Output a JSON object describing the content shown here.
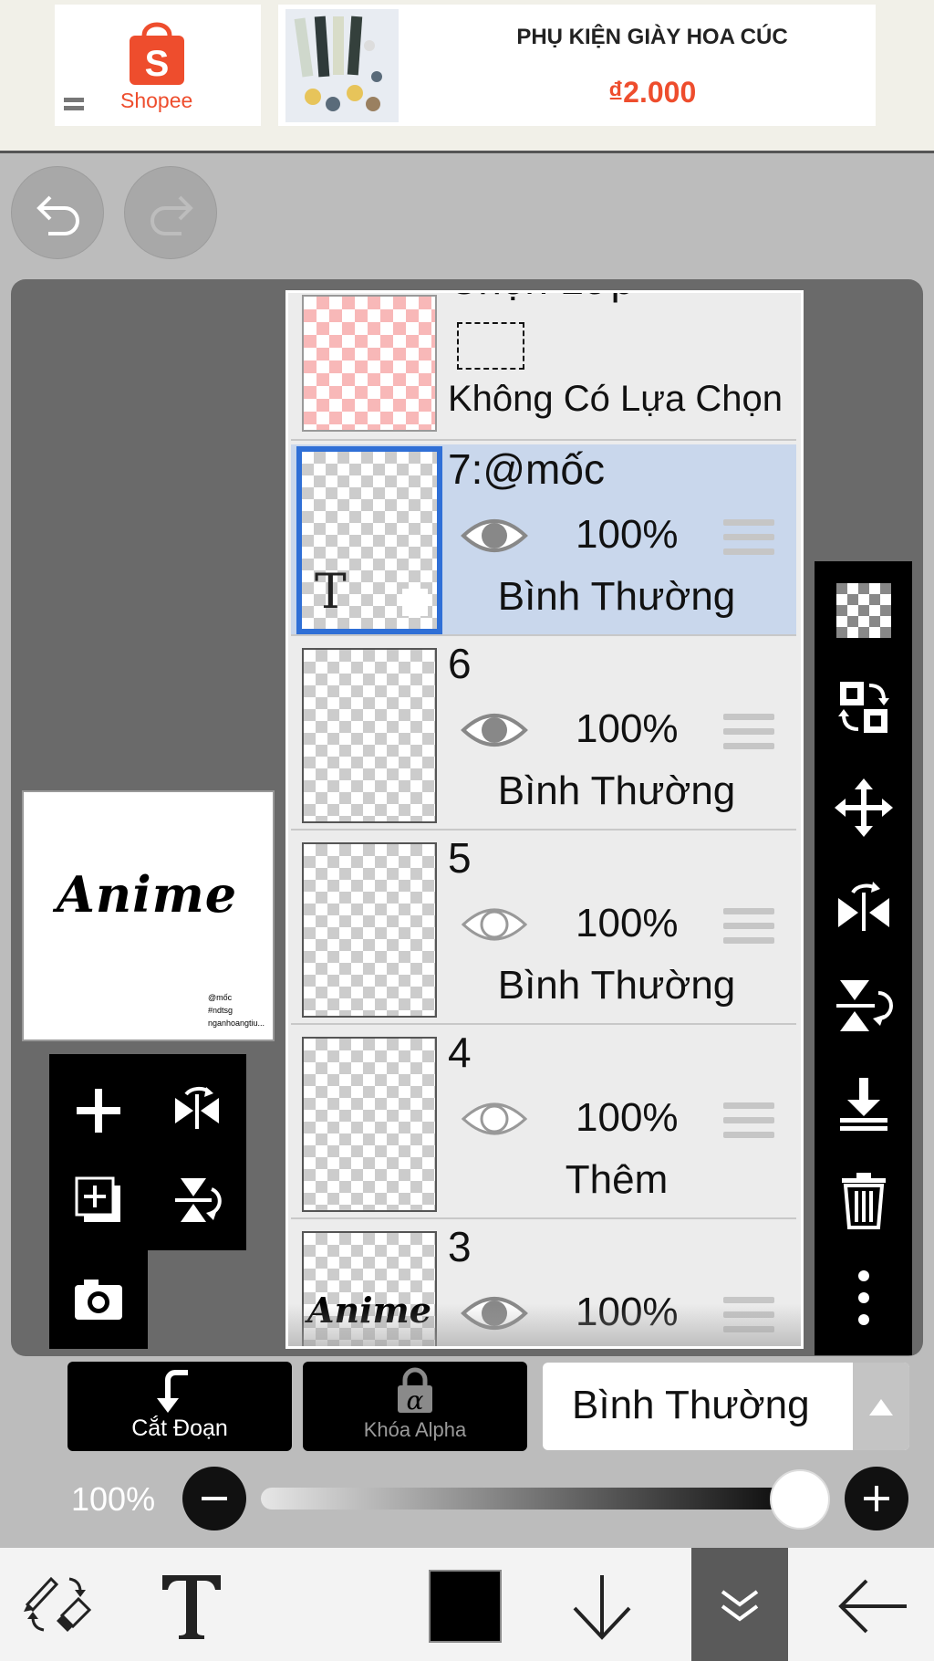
{
  "ad": {
    "brand": "Shopee",
    "product_title": "PHỤ KIỆN GIÀY HOA CÚC",
    "price": "₫2.000",
    "brand_color": "#ee4d2d"
  },
  "history": {
    "undo_icon": "undo-icon",
    "redo_icon": "redo-icon"
  },
  "layers": {
    "selection_layer": {
      "title": "Chọn Lớp",
      "status": "Không Có Lựa Chọn"
    },
    "items": [
      {
        "name": "7:@mốc",
        "opacity": "100%",
        "mode": "Bình Thường",
        "visible": true,
        "selected": true,
        "type": "text"
      },
      {
        "name": "6",
        "opacity": "100%",
        "mode": "Bình Thường",
        "visible": true,
        "selected": false,
        "type": "raster"
      },
      {
        "name": "5",
        "opacity": "100%",
        "mode": "Bình Thường",
        "visible": false,
        "selected": false,
        "type": "raster"
      },
      {
        "name": "4",
        "opacity": "100%",
        "mode": "Thêm",
        "visible": false,
        "selected": false,
        "type": "raster"
      },
      {
        "name": "3",
        "opacity": "100%",
        "mode": "",
        "visible": true,
        "selected": false,
        "type": "raster"
      }
    ]
  },
  "preview": {
    "title_text": "Anime",
    "credit_lines": [
      "@mốc",
      "#ndtsg",
      "nganhoangtiu..."
    ],
    "layer3_thumb_text": "Anime",
    "layer7_thumb_text": "T"
  },
  "bottom_panel": {
    "clipping_label": "Cắt Đoạn",
    "alpha_lock_label": "Khóa Alpha",
    "alpha_symbol": "α",
    "blend_mode": "Bình Thường",
    "opacity_value": "100%",
    "opacity_fraction": 1.0
  },
  "colors": {
    "current_color": "#000000",
    "selection_highlight": "#c9d7ec",
    "selection_border": "#2f6fd6"
  }
}
